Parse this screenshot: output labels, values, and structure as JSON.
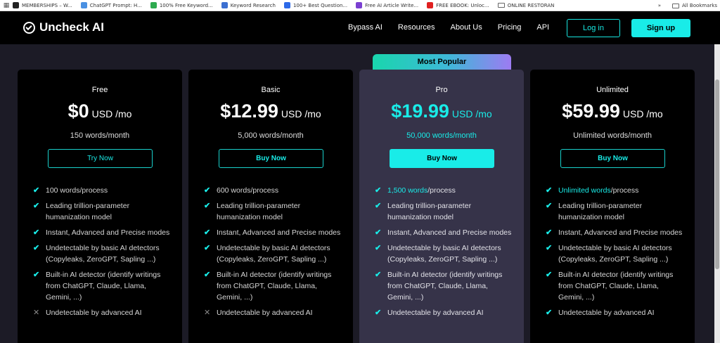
{
  "bookmarks": {
    "items": [
      {
        "label": "MEMBERSHIPS – W...",
        "color": "#222222"
      },
      {
        "label": "ChatGPT Prompt: H...",
        "color": "#4a90e2"
      },
      {
        "label": "100% Free Keyword...",
        "color": "#2eaa4f"
      },
      {
        "label": "Keyword Research",
        "color": "#3b6fd1"
      },
      {
        "label": "100+ Best Question...",
        "color": "#2d6ae8"
      },
      {
        "label": "Free AI Article Write...",
        "color": "#7a3fd1"
      },
      {
        "label": "FREE EBOOK: Unloc...",
        "color": "#e02020"
      },
      {
        "label": "ONLINE RESTORAN",
        "color": "#777777"
      }
    ],
    "more": "»",
    "all_bookmarks": "All Bookmarks"
  },
  "nav": {
    "logo": "Uncheck AI",
    "links": [
      "Bypass AI",
      "Resources",
      "About Us",
      "Pricing",
      "API"
    ],
    "login": "Log in",
    "signup": "Sign up"
  },
  "colors": {
    "accent": "#19ece8",
    "card_bg": "#000000",
    "pro_bg": "#363349",
    "page_bg": "#1c1b26"
  },
  "pricing": {
    "popular_tag": "Most Popular",
    "plans": [
      {
        "name": "Free",
        "price": "$0",
        "unit": "USD /mo",
        "words": "150 words/month",
        "cta": "Try Now",
        "features": [
          {
            "hl": "",
            "text": "100 words/process",
            "type": "check"
          },
          {
            "hl": "",
            "text": "Leading trillion-parameter humanization model",
            "type": "check"
          },
          {
            "hl": "",
            "text": "Instant, Advanced and Precise modes",
            "type": "check"
          },
          {
            "hl": "",
            "text": "Undetectable by basic AI detectors (Copyleaks, ZeroGPT, Sapling ...)",
            "type": "check"
          },
          {
            "hl": "",
            "text": "Built-in AI detector (identify writings from ChatGPT, Claude, Llama, Gemini, ...)",
            "type": "check"
          },
          {
            "hl": "",
            "text": "Undetectable by advanced AI",
            "type": "cross"
          }
        ]
      },
      {
        "name": "Basic",
        "price": "$12.99",
        "unit": "USD /mo",
        "words": "5,000 words/month",
        "cta": "Buy Now",
        "features": [
          {
            "hl": "",
            "text": "600 words/process",
            "type": "check"
          },
          {
            "hl": "",
            "text": "Leading trillion-parameter humanization model",
            "type": "check"
          },
          {
            "hl": "",
            "text": "Instant, Advanced and Precise modes",
            "type": "check"
          },
          {
            "hl": "",
            "text": "Undetectable by basic AI detectors (Copyleaks, ZeroGPT, Sapling ...)",
            "type": "check"
          },
          {
            "hl": "",
            "text": "Built-in AI detector (identify writings from ChatGPT, Claude, Llama, Gemini, ...)",
            "type": "check"
          },
          {
            "hl": "",
            "text": "Undetectable by advanced AI",
            "type": "cross"
          }
        ]
      },
      {
        "name": "Pro",
        "price": "$19.99",
        "unit": "USD /mo",
        "words": "50,000 words/month",
        "cta": "Buy Now",
        "features": [
          {
            "hl": "1,500 words",
            "text": "/process",
            "type": "check"
          },
          {
            "hl": "",
            "text": "Leading trillion-parameter humanization model",
            "type": "check"
          },
          {
            "hl": "",
            "text": "Instant, Advanced and Precise modes",
            "type": "check"
          },
          {
            "hl": "",
            "text": "Undetectable by basic AI detectors (Copyleaks, ZeroGPT, Sapling ...)",
            "type": "check"
          },
          {
            "hl": "",
            "text": "Built-in AI detector (identify writings from ChatGPT, Claude, Llama, Gemini, ...)",
            "type": "check"
          },
          {
            "hl": "",
            "text": "Undetectable by advanced AI",
            "type": "check"
          }
        ]
      },
      {
        "name": "Unlimited",
        "price": "$59.99",
        "unit": "USD /mo",
        "words": "Unlimited words/month",
        "cta": "Buy Now",
        "features": [
          {
            "hl": "Unlimited words",
            "text": "/process",
            "type": "check"
          },
          {
            "hl": "",
            "text": "Leading trillion-parameter humanization model",
            "type": "check"
          },
          {
            "hl": "",
            "text": "Instant, Advanced and Precise modes",
            "type": "check"
          },
          {
            "hl": "",
            "text": "Undetectable by basic AI detectors (Copyleaks, ZeroGPT, Sapling ...)",
            "type": "check"
          },
          {
            "hl": "",
            "text": "Built-in AI detector (identify writings from ChatGPT, Claude, Llama, Gemini, ...)",
            "type": "check"
          },
          {
            "hl": "",
            "text": "Undetectable by advanced AI",
            "type": "check"
          }
        ]
      }
    ]
  }
}
